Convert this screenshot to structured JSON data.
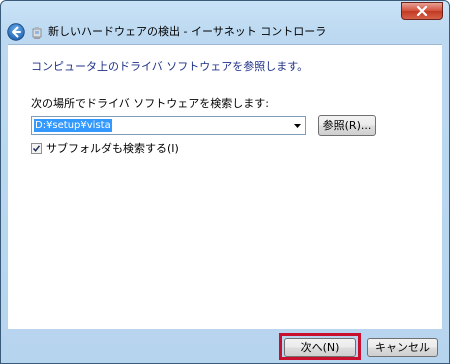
{
  "window": {
    "title": "新しいハードウェアの検出 - イーサネット コントローラ"
  },
  "content": {
    "heading": "コンピュータ上のドライバ ソフトウェアを参照します。",
    "path_label": "次の場所でドライバ ソフトウェアを検索します:",
    "path_value": "D:¥setup¥vista",
    "browse_button": "参照(R)...",
    "include_subfolders_label": "サブフォルダも検索する(I)",
    "include_subfolders_checked": true
  },
  "footer": {
    "next_button": "次へ(N)",
    "cancel_button": "キャンセル"
  },
  "icons": {
    "back": "back-arrow-icon",
    "device": "network-device-icon",
    "close": "close-icon",
    "dropdown": "chevron-down-icon",
    "check": "check-icon"
  },
  "colors": {
    "heading": "#1e3287",
    "selection": "#3399ff",
    "highlight_border": "#c8102e",
    "close_button": "#c94a35"
  }
}
